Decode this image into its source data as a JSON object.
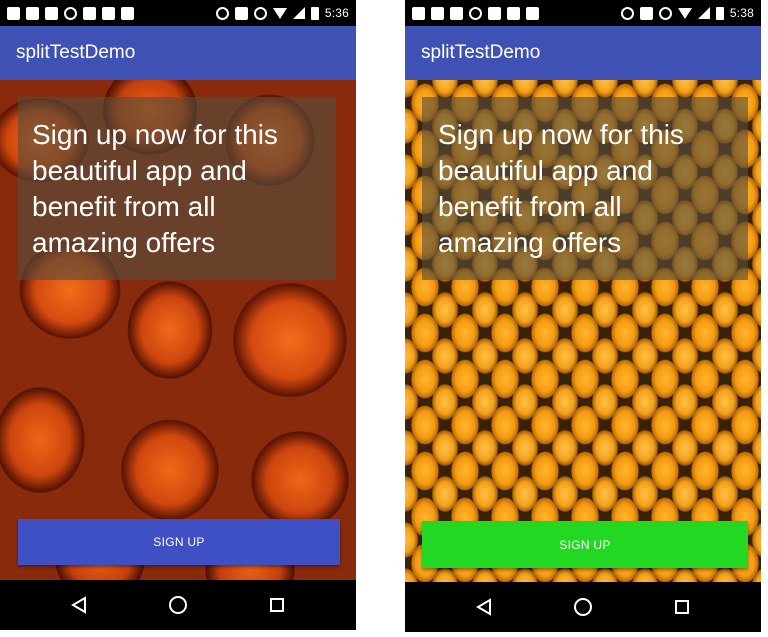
{
  "screens": [
    {
      "status_time": "5:36",
      "app_title": "splitTestDemo",
      "headline": "Sign up now for this beautiful app and benefit from all amazing offers",
      "button_label": "SIGN UP",
      "button_color": "#3f4fc4",
      "background": "oranges"
    },
    {
      "status_time": "5:38",
      "app_title": "splitTestDemo",
      "headline": "Sign up now for this beautiful app and benefit from all amazing offers",
      "button_label": "SIGN UP",
      "button_color": "#22d822",
      "background": "kumquats"
    }
  ],
  "nav": {
    "back_icon": "back-triangle-icon",
    "home_icon": "home-circle-icon",
    "recents_icon": "recents-square-icon"
  },
  "colors": {
    "app_bar": "#3f51b5"
  }
}
